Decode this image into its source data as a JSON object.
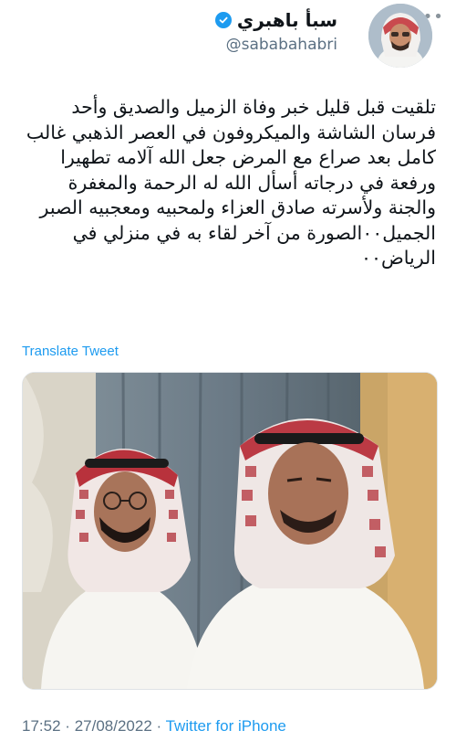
{
  "author": {
    "display_name": "سبأ باهبري",
    "handle": "@sababahabri",
    "verified": true
  },
  "more_icon": "more-horizontal-icon",
  "tweet": {
    "text": "تلقيت قبل قليل خبر وفاة الزميل والصديق وأحد فرسان الشاشة والميكروفون في العصر الذهبي غالب كامل بعد صراع مع المرض جعل الله آلامه تطهيرا ورفعة في درجاته أسأل الله له الرحمة والمغفرة والجنة ولأسرته صادق العزاء ولمحبيه ومعجبيه الصبر الجميل٠٠الصورة من آخر لقاء به في منزلي في الرياض٠٠",
    "translate_label": "Translate Tweet"
  },
  "meta": {
    "time": "17:52",
    "separator": "·",
    "date": "27/08/2022",
    "source": "Twitter for iPhone"
  },
  "colors": {
    "accent": "#1d9bf0",
    "secondary_text": "#5b7083"
  }
}
